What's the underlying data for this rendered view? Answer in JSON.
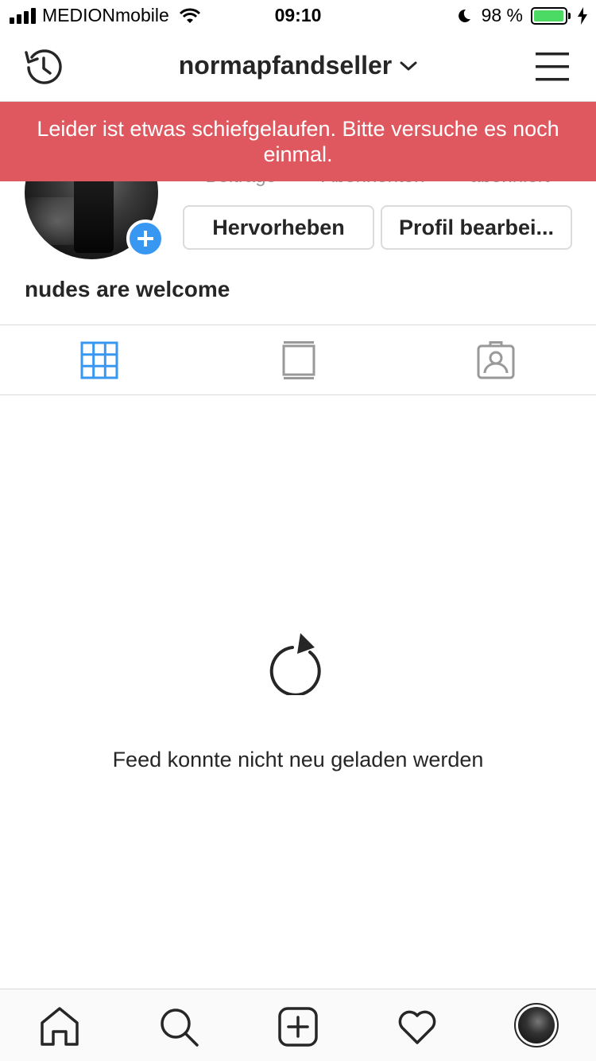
{
  "status_bar": {
    "carrier": "MEDIONmobile",
    "time": "09:10",
    "battery": "98 %",
    "battery_level": 0.98,
    "icons": [
      "signal-icon",
      "wifi-icon",
      "moon-icon",
      "battery-icon",
      "charging-icon"
    ]
  },
  "header": {
    "username": "normapfandseller",
    "icons": [
      "history-icon",
      "chevron-down-icon",
      "menu-icon"
    ]
  },
  "error_banner": {
    "message": "Leider ist etwas schiefgelaufen. Bitte versuche es noch einmal."
  },
  "profile": {
    "stats": {
      "posts_label": "Beiträge",
      "followers_label": "Abonnenten",
      "following_label": "abonniert"
    },
    "highlight_button": "Hervorheben",
    "edit_button": "Profil bearbei...",
    "bio": "nudes are welcome"
  },
  "tabs": {
    "active": "grid",
    "items": [
      "grid-icon",
      "feed-icon",
      "tagged-icon"
    ]
  },
  "feed": {
    "error_message": "Feed konnte nicht neu geladen werden"
  },
  "bottom_nav": {
    "items": [
      "home-icon",
      "search-icon",
      "add-icon",
      "heart-icon",
      "profile-avatar"
    ]
  },
  "colors": {
    "banner_red": "#e0585f",
    "accent_blue": "#3897f0",
    "battery_green": "#4cd964"
  }
}
